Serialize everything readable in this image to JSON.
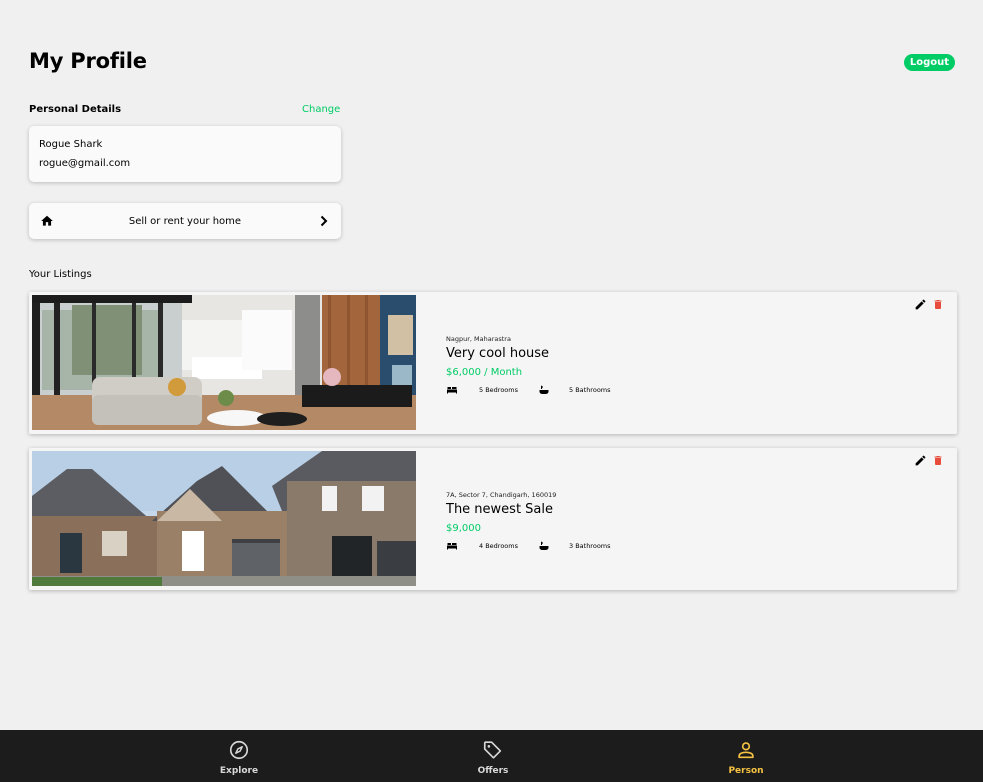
{
  "header": {
    "title": "My Profile",
    "logout_label": "Logout"
  },
  "personal_details": {
    "label": "Personal Details",
    "change_label": "Change",
    "name": "Rogue Shark",
    "email": "rogue@gmail.com"
  },
  "sell_card": {
    "label": "Sell or rent your home",
    "icon": "home-icon"
  },
  "listings_section": {
    "label": "Your Listings"
  },
  "listings": [
    {
      "location": "Nagpur, Maharastra",
      "name": "Very cool house",
      "price": "$6,000 / Month",
      "bedrooms": "5 Bedrooms",
      "bathrooms": "5 Bathrooms"
    },
    {
      "location": "7A, Sector 7, Chandigarh, 160019",
      "name": "The newest Sale",
      "price": "$9,000",
      "bedrooms": "4 Bedrooms",
      "bathrooms": "3 Bathrooms"
    }
  ],
  "nav": {
    "items": [
      {
        "label": "Explore",
        "icon": "compass-icon"
      },
      {
        "label": "Offers",
        "icon": "tag-icon"
      },
      {
        "label": "Person",
        "icon": "person-icon"
      }
    ],
    "active": "Person"
  },
  "colors": {
    "accent_green": "#00cc66",
    "active_nav": "#f5c242",
    "delete_red": "#e74c3c",
    "navbar_bg": "#1c1c1c",
    "page_bg": "#f0f0f0"
  }
}
